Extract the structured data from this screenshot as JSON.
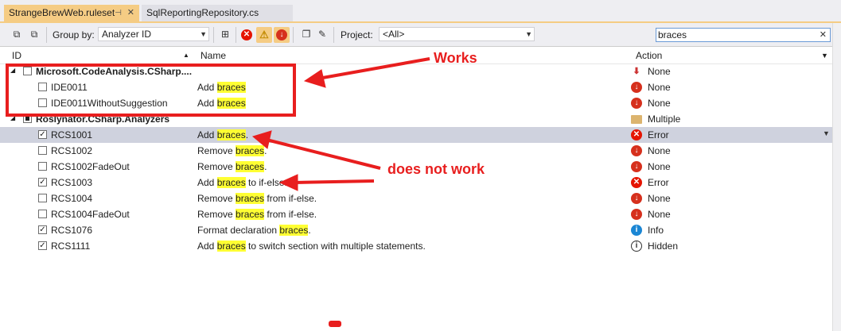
{
  "tabs": [
    {
      "label": "StrangeBrewWeb.ruleset",
      "pin": "⊣",
      "close": "✕"
    },
    {
      "label": "SqlReportingRepository.cs"
    }
  ],
  "toolbar": {
    "group_by_label": "Group by:",
    "group_by_value": "Analyzer ID",
    "project_label": "Project:",
    "project_value": "<All>",
    "search_value": "braces"
  },
  "columns": {
    "id": "ID",
    "name": "Name",
    "action": "Action"
  },
  "rows": [
    {
      "type": "group",
      "id": "Microsoft.CodeAnalysis.CSharp....",
      "name": "",
      "action": "None",
      "action_icon": "none-muted"
    },
    {
      "type": "rule",
      "checked": false,
      "id": "IDE0011",
      "name_pre": "Add ",
      "name_hl": "braces",
      "name_post": "",
      "action": "None",
      "action_icon": "none"
    },
    {
      "type": "rule",
      "checked": false,
      "id": "IDE0011WithoutSuggestion",
      "name_pre": "Add ",
      "name_hl": "braces",
      "name_post": "",
      "action": "None",
      "action_icon": "none"
    },
    {
      "type": "group",
      "id": "Roslynator.CSharp.Analyzers",
      "name": "",
      "action": "Multiple",
      "action_icon": "folder"
    },
    {
      "type": "rule",
      "checked": true,
      "selected": true,
      "id": "RCS1001",
      "name_pre": "Add ",
      "name_hl": "braces",
      "name_post": ".",
      "action": "Error",
      "action_icon": "err"
    },
    {
      "type": "rule",
      "checked": false,
      "id": "RCS1002",
      "name_pre": "Remove ",
      "name_hl": "braces",
      "name_post": ".",
      "action": "None",
      "action_icon": "none"
    },
    {
      "type": "rule",
      "checked": false,
      "id": "RCS1002FadeOut",
      "name_pre": "Remove ",
      "name_hl": "braces",
      "name_post": ".",
      "action": "None",
      "action_icon": "none"
    },
    {
      "type": "rule",
      "checked": true,
      "id": "RCS1003",
      "name_pre": "Add ",
      "name_hl": "braces",
      "name_post": " to if-else.",
      "action": "Error",
      "action_icon": "err"
    },
    {
      "type": "rule",
      "checked": false,
      "id": "RCS1004",
      "name_pre": "Remove ",
      "name_hl": "braces",
      "name_post": " from if-else.",
      "action": "None",
      "action_icon": "none"
    },
    {
      "type": "rule",
      "checked": false,
      "id": "RCS1004FadeOut",
      "name_pre": "Remove ",
      "name_hl": "braces",
      "name_post": " from if-else.",
      "action": "None",
      "action_icon": "none"
    },
    {
      "type": "rule",
      "checked": true,
      "id": "RCS1076",
      "name_pre": "Format declaration ",
      "name_hl": "braces",
      "name_post": ".",
      "action": "Info",
      "action_icon": "info"
    },
    {
      "type": "rule",
      "checked": true,
      "id": "RCS1111",
      "name_pre": "Add ",
      "name_hl": "braces",
      "name_post": " to switch section with multiple statements.",
      "action": "Hidden",
      "action_icon": "hidden"
    }
  ],
  "annotations": {
    "works": "Works",
    "does_not_work": "does not work"
  },
  "colors": {
    "annotation_red": "#e81e1e",
    "highlight": "#ffff33",
    "selected_row": "#cfd2de",
    "active_tab": "#f5cc84"
  }
}
